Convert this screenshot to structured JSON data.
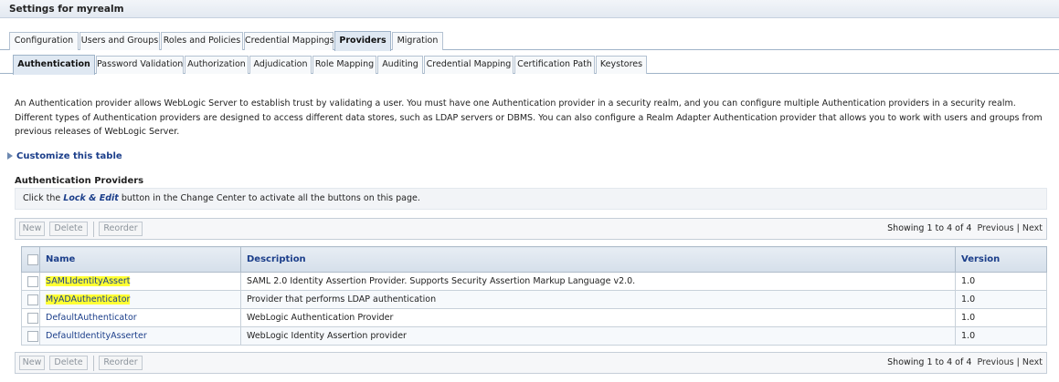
{
  "page": {
    "title": "Settings for myrealm"
  },
  "top_tabs": [
    {
      "label": "Configuration",
      "active": false
    },
    {
      "label": "Users and Groups",
      "active": false
    },
    {
      "label": "Roles and Policies",
      "active": false
    },
    {
      "label": "Credential Mappings",
      "active": false
    },
    {
      "label": "Providers",
      "active": true
    },
    {
      "label": "Migration",
      "active": false
    }
  ],
  "sub_tabs": [
    {
      "label": "Authentication",
      "active": true
    },
    {
      "label": "Password Validation",
      "active": false
    },
    {
      "label": "Authorization",
      "active": false
    },
    {
      "label": "Adjudication",
      "active": false
    },
    {
      "label": "Role Mapping",
      "active": false
    },
    {
      "label": "Auditing",
      "active": false
    },
    {
      "label": "Credential Mapping",
      "active": false
    },
    {
      "label": "Certification Path",
      "active": false
    },
    {
      "label": "Keystores",
      "active": false
    }
  ],
  "description": "An Authentication provider allows WebLogic Server to establish trust by validating a user. You must have one Authentication provider in a security realm, and you can configure multiple Authentication providers in a security realm. Different types of Authentication providers are designed to access different data stores, such as LDAP servers or DBMS. You can also configure a Realm Adapter Authentication provider that allows you to work with users and groups from previous releases of WebLogic Server.",
  "customize_link": "Customize this table",
  "section_title": "Authentication Providers",
  "instruction": {
    "prefix": "Click the ",
    "lock_label": "Lock & Edit",
    "suffix": " button in the Change Center to activate all the buttons on this page."
  },
  "toolbar": {
    "new_label": "New",
    "delete_label": "Delete",
    "reorder_label": "Reorder",
    "showing_text": "Showing 1 to 4 of 4",
    "previous_label": "Previous",
    "separator": "|",
    "next_label": "Next"
  },
  "table": {
    "headers": {
      "name": "Name",
      "description": "Description",
      "version": "Version"
    },
    "rows": [
      {
        "name": "SAMLIdentityAssert",
        "description": "SAML 2.0 Identity Assertion Provider. Supports Security Assertion Markup Language v2.0.",
        "version": "1.0",
        "highlighted": true
      },
      {
        "name": "MyADAuthenticator",
        "description": "Provider that performs LDAP authentication",
        "version": "1.0",
        "highlighted": true
      },
      {
        "name": "DefaultAuthenticator",
        "description": "WebLogic Authentication Provider",
        "version": "1.0",
        "highlighted": false
      },
      {
        "name": "DefaultIdentityAsserter",
        "description": "WebLogic Identity Assertion provider",
        "version": "1.0",
        "highlighted": false
      }
    ]
  },
  "colors": {
    "link": "#1b3e8a",
    "highlight": "#ffff33",
    "tab_active": "#dfe8f2"
  }
}
